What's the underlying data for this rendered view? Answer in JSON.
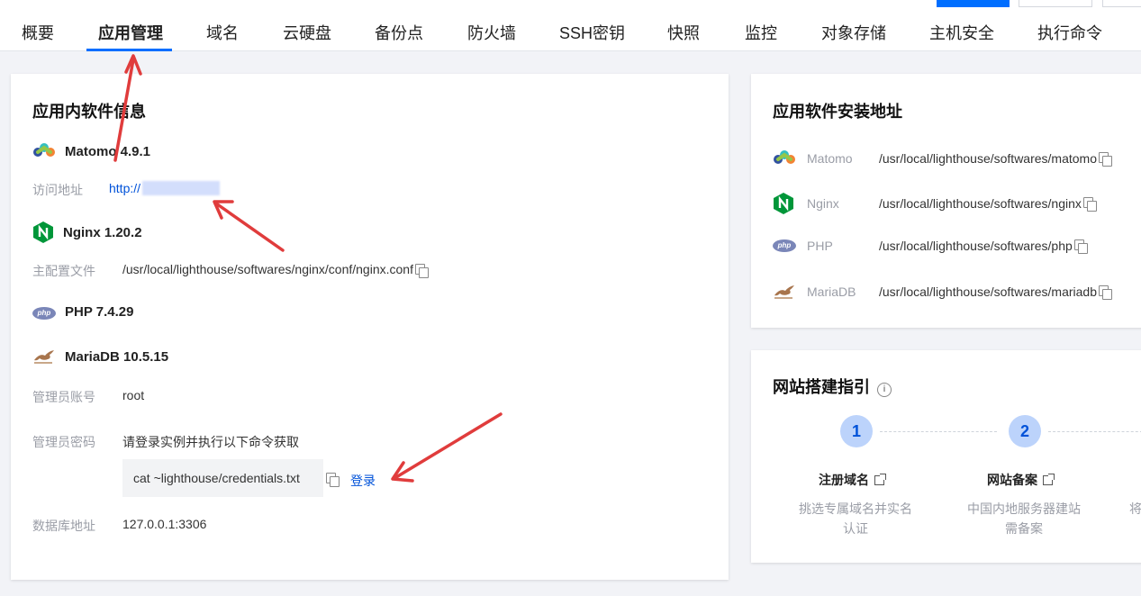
{
  "tabs": [
    {
      "label": "概要"
    },
    {
      "label": "应用管理"
    },
    {
      "label": "域名"
    },
    {
      "label": "云硬盘"
    },
    {
      "label": "备份点"
    },
    {
      "label": "防火墙"
    },
    {
      "label": "SSH密钥"
    },
    {
      "label": "快照"
    },
    {
      "label": "监控"
    },
    {
      "label": "对象存储"
    },
    {
      "label": "主机安全"
    },
    {
      "label": "执行命令"
    }
  ],
  "active_tab": "应用管理",
  "app_info": {
    "title": "应用内软件信息",
    "matomo": {
      "name": "Matomo 4.9.1",
      "access_label": "访问地址",
      "access_url": "http://"
    },
    "nginx": {
      "name": "Nginx 1.20.2",
      "config_label": "主配置文件",
      "config_path": "/usr/local/lighthouse/softwares/nginx/conf/nginx.conf"
    },
    "php": {
      "name": "PHP 7.4.29"
    },
    "mariadb": {
      "name": "MariaDB 10.5.15",
      "admin_account_label": "管理员账号",
      "admin_account": "root",
      "admin_password_label": "管理员密码",
      "admin_password_hint": "请登录实例并执行以下命令获取",
      "command": "cat ~lighthouse/credentials.txt",
      "login_link": "登录",
      "db_address_label": "数据库地址",
      "db_address": "127.0.0.1:3306"
    }
  },
  "install_paths": {
    "title": "应用软件安装地址",
    "items": [
      {
        "name": "Matomo",
        "path": "/usr/local/lighthouse/softwares/matomo",
        "icon": "matomo-logo"
      },
      {
        "name": "Nginx",
        "path": "/usr/local/lighthouse/softwares/nginx",
        "icon": "nginx-logo"
      },
      {
        "name": "PHP",
        "path": "/usr/local/lighthouse/softwares/php",
        "icon": "php-logo"
      },
      {
        "name": "MariaDB",
        "path": "/usr/local/lighthouse/softwares/mariadb",
        "icon": "mariadb-logo"
      }
    ]
  },
  "site_guide": {
    "title": "网站搭建指引",
    "steps": [
      {
        "number": "1",
        "title": "注册域名",
        "desc_line1": "挑选专属域名并实名",
        "desc_line2": "认证"
      },
      {
        "number": "2",
        "title": "网站备案",
        "desc_line1": "中国内地服务器建站",
        "desc_line2": "需备案"
      }
    ],
    "clipped_text": "将"
  },
  "php_logo_text": "php",
  "colors": {
    "accent": "#006eff",
    "link": "#0052d9",
    "annotation_arrow": "#e03c3c"
  }
}
